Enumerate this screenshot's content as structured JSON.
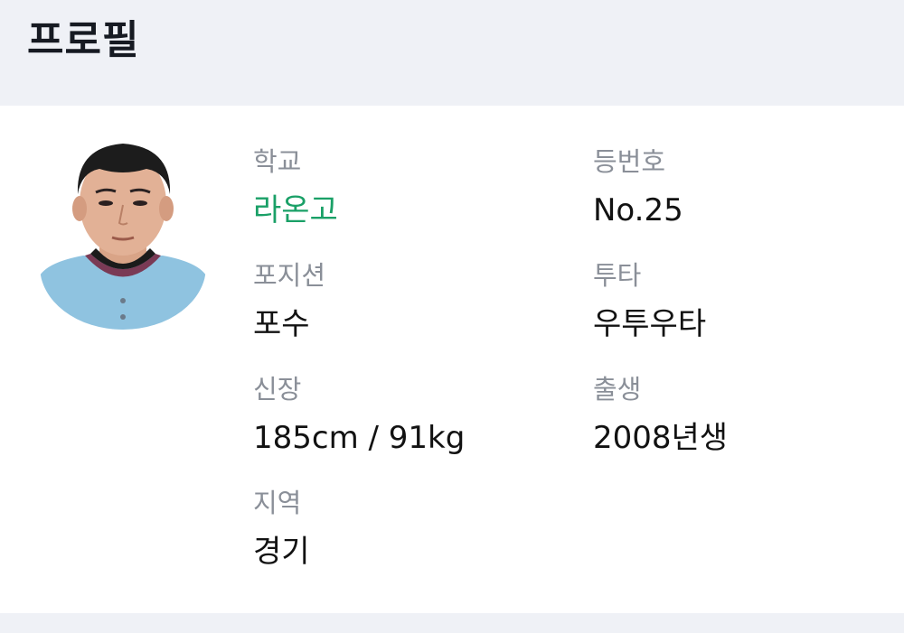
{
  "header": {
    "title": "프로필"
  },
  "profile": {
    "school": {
      "label": "학교",
      "value": "라온고",
      "color": "#1aa067"
    },
    "number": {
      "label": "등번호",
      "value": "No.25"
    },
    "position": {
      "label": "포지션",
      "value": "포수"
    },
    "throw_bat": {
      "label": "투타",
      "value": "우투우타"
    },
    "body": {
      "label": "신장",
      "value": "185cm / 91kg"
    },
    "birth": {
      "label": "출생",
      "value": "2008년생"
    },
    "region": {
      "label": "지역",
      "value": "경기"
    }
  },
  "colors": {
    "background": "#eff1f6",
    "card": "#ffffff",
    "label": "#8a8f98",
    "value": "#121212",
    "accent": "#1aa067"
  }
}
